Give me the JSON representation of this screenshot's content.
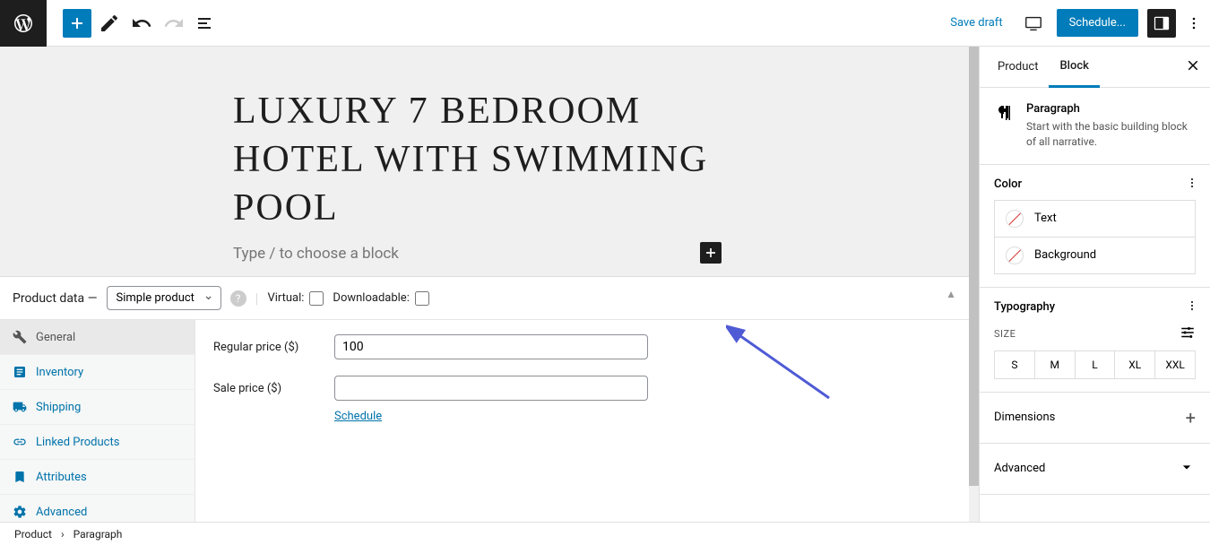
{
  "toolbar": {
    "save_draft": "Save draft",
    "schedule": "Schedule..."
  },
  "editor": {
    "title": "LUXURY 7 BEDROOM HOTEL WITH SWIMMING POOL",
    "block_placeholder": "Type / to choose a block"
  },
  "product_data": {
    "header_label": "Product data —",
    "type_selected": "Simple product",
    "virtual_label": "Virtual:",
    "downloadable_label": "Downloadable:",
    "tabs": [
      "General",
      "Inventory",
      "Shipping",
      "Linked Products",
      "Attributes",
      "Advanced"
    ],
    "regular_price_label": "Regular price ($)",
    "regular_price_value": "100",
    "sale_price_label": "Sale price ($)",
    "sale_price_value": "",
    "schedule_link": "Schedule"
  },
  "sidebar": {
    "tabs": {
      "product": "Product",
      "block": "Block"
    },
    "block_name": "Paragraph",
    "block_desc": "Start with the basic building block of all narrative.",
    "color_section": "Color",
    "color_text": "Text",
    "color_background": "Background",
    "typography_section": "Typography",
    "size_label": "SIZE",
    "sizes": [
      "S",
      "M",
      "L",
      "XL",
      "XXL"
    ],
    "dimensions_section": "Dimensions",
    "advanced_section": "Advanced"
  },
  "breadcrumb": {
    "root": "Product",
    "current": "Paragraph"
  }
}
